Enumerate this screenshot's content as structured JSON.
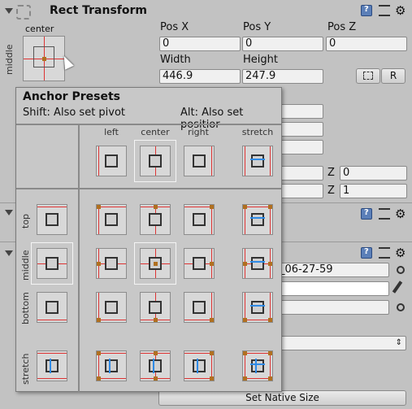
{
  "rect_transform": {
    "title": "Rect Transform",
    "anchor_col_label": "center",
    "anchor_row_label": "middle",
    "labels": {
      "pos_x": "Pos X",
      "pos_y": "Pos Y",
      "pos_z": "Pos Z",
      "width": "Width",
      "height": "Height"
    },
    "values": {
      "pos_x": "0",
      "pos_y": "0",
      "pos_z": "0",
      "width": "446.9",
      "height": "247.9"
    },
    "raw_edit_btn": "R",
    "z_label": "Z",
    "z_values": [
      "0",
      "1"
    ]
  },
  "anchor_presets": {
    "title": "Anchor Presets",
    "hint_shift": "Shift: Also set pivot",
    "hint_alt": "Alt: Also set positior",
    "columns": [
      "left",
      "center",
      "right",
      "stretch"
    ],
    "rows": [
      "top",
      "middle",
      "bottom",
      "stretch"
    ]
  },
  "background_component": {
    "field_value": "_06-27-59"
  },
  "set_native_size_btn": "Set Native Size"
}
